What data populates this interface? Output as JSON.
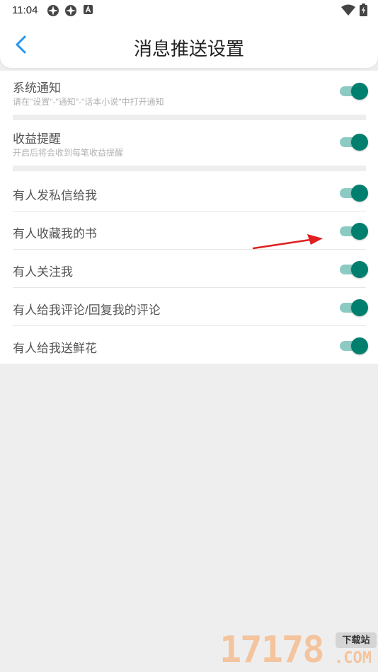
{
  "status_bar": {
    "time": "11:04"
  },
  "header": {
    "title": "消息推送设置"
  },
  "settings": [
    {
      "title": "系统通知",
      "subtitle": "请在\"设置\"-\"通知\"-\"话本小说\"中打开通知",
      "enabled": true
    },
    {
      "title": "收益提醒",
      "subtitle": "开启后将会收到每笔收益提醒",
      "enabled": true
    },
    {
      "title": "有人发私信给我",
      "enabled": true
    },
    {
      "title": "有人收藏我的书",
      "enabled": true
    },
    {
      "title": "有人关注我",
      "enabled": true
    },
    {
      "title": "有人给我评论/回复我的评论",
      "enabled": true
    },
    {
      "title": "有人给我送鲜花",
      "enabled": true
    }
  ],
  "colors": {
    "accent": "#007f6e",
    "toggle_track": "#8ccbc3",
    "back_arrow": "#2196f3",
    "annotation_arrow": "#e02020"
  },
  "watermark": {
    "number": "17178",
    "badge": "下载站",
    "domain": ".COM"
  }
}
